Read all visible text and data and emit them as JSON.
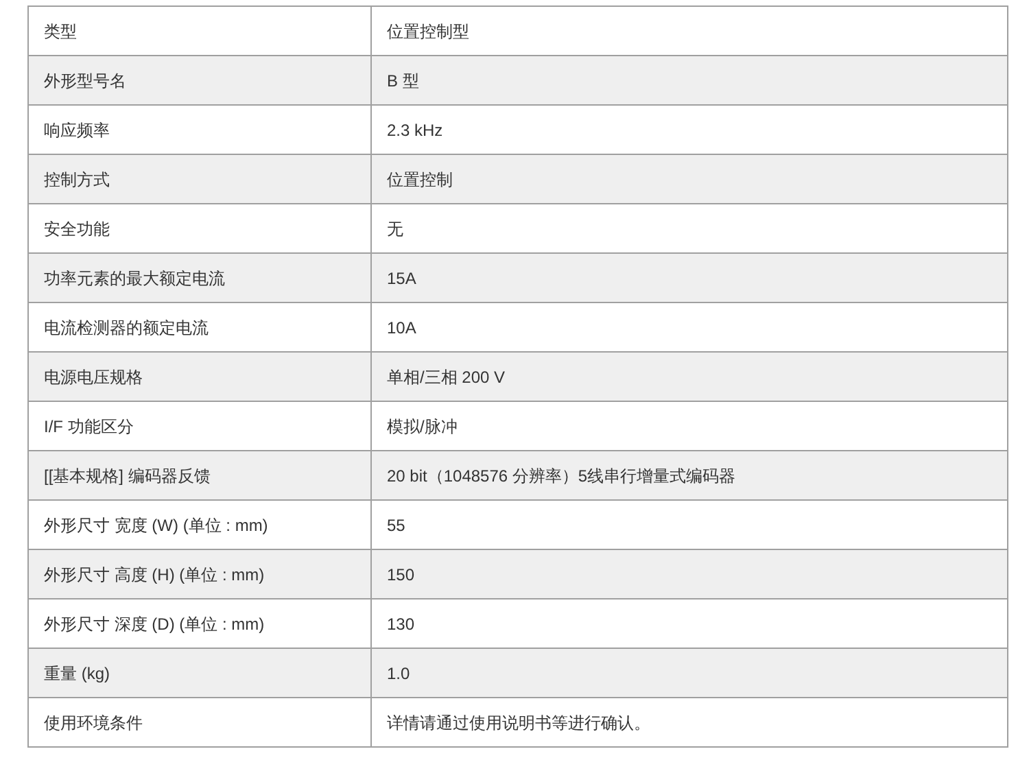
{
  "table": {
    "rows": [
      {
        "label": "类型",
        "value": "位置控制型"
      },
      {
        "label": "外形型号名",
        "value": "B 型"
      },
      {
        "label": "响应频率",
        "value": "2.3 kHz"
      },
      {
        "label": "控制方式",
        "value": "位置控制"
      },
      {
        "label": "安全功能",
        "value": "无"
      },
      {
        "label": "功率元素的最大额定电流",
        "value": "15A"
      },
      {
        "label": "电流检测器的额定电流",
        "value": "10A"
      },
      {
        "label": "电源电压规格",
        "value": "单相/三相 200 V"
      },
      {
        "label": "I/F 功能区分",
        "value": "模拟/脉冲"
      },
      {
        "label": "[[基本规格] 编码器反馈",
        "value": "20 bit（1048576 分辨率）5线串行增量式编码器"
      },
      {
        "label": "外形尺寸 宽度 (W) (单位 : mm)",
        "value": "55"
      },
      {
        "label": "外形尺寸 高度 (H) (单位 : mm)",
        "value": "150"
      },
      {
        "label": "外形尺寸 深度 (D) (单位 : mm)",
        "value": "130"
      },
      {
        "label": "重量 (kg)",
        "value": "1.0"
      },
      {
        "label": "使用环境条件",
        "value": "详情请通过使用说明书等进行确认。"
      }
    ]
  }
}
